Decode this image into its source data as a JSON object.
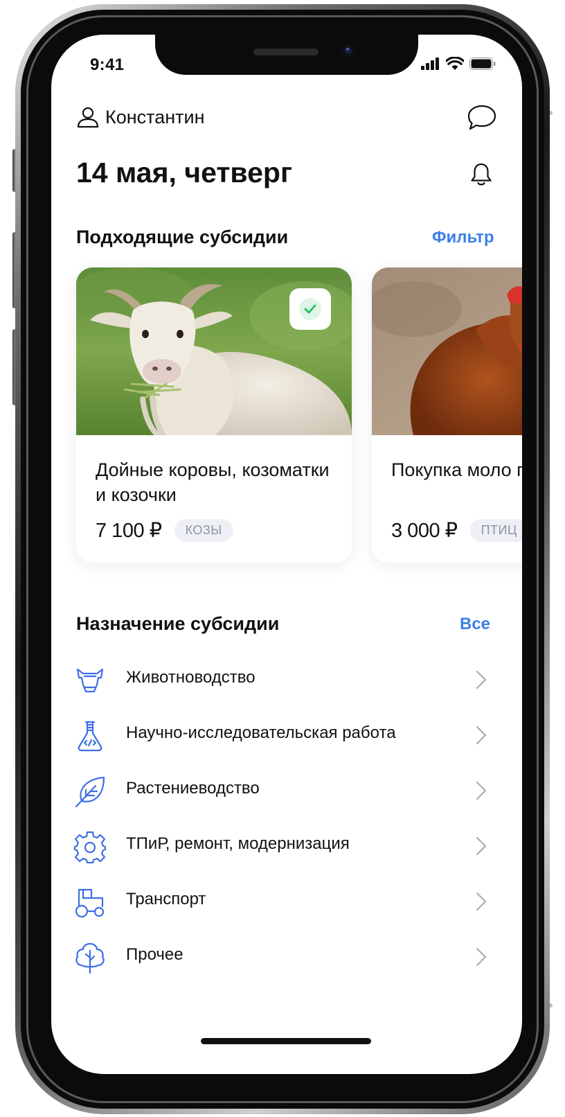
{
  "status_bar": {
    "time": "9:41"
  },
  "header": {
    "user_name": "Константин",
    "date": "14 мая, четверг"
  },
  "subsidies": {
    "title": "Подходящие субсидии",
    "filter_label": "Фильтр",
    "cards": [
      {
        "title": "Дойные коровы, козоматки и козочки",
        "price": "7 100 ₽",
        "tag": "КОЗЫ",
        "checked": true
      },
      {
        "title": "Покупка моло птицы",
        "price": "3 000 ₽",
        "tag": "ПТИЦ",
        "checked": false
      }
    ]
  },
  "purpose": {
    "title": "Назначение субсидии",
    "all_label": "Все",
    "items": [
      {
        "label": "Животноводство",
        "icon": "cow-icon"
      },
      {
        "label": "Научно-исследовательская работа",
        "icon": "flask-icon"
      },
      {
        "label": "Растениеводство",
        "icon": "leaf-icon"
      },
      {
        "label": "ТПиР, ремонт, модернизация",
        "icon": "gear-icon"
      },
      {
        "label": "Транспорт",
        "icon": "tractor-icon"
      },
      {
        "label": "Прочее",
        "icon": "tree-icon"
      }
    ]
  },
  "colors": {
    "accent": "#3d7fe9",
    "icon_blue": "#3d6ee6",
    "check_green": "#2fbf6a"
  }
}
